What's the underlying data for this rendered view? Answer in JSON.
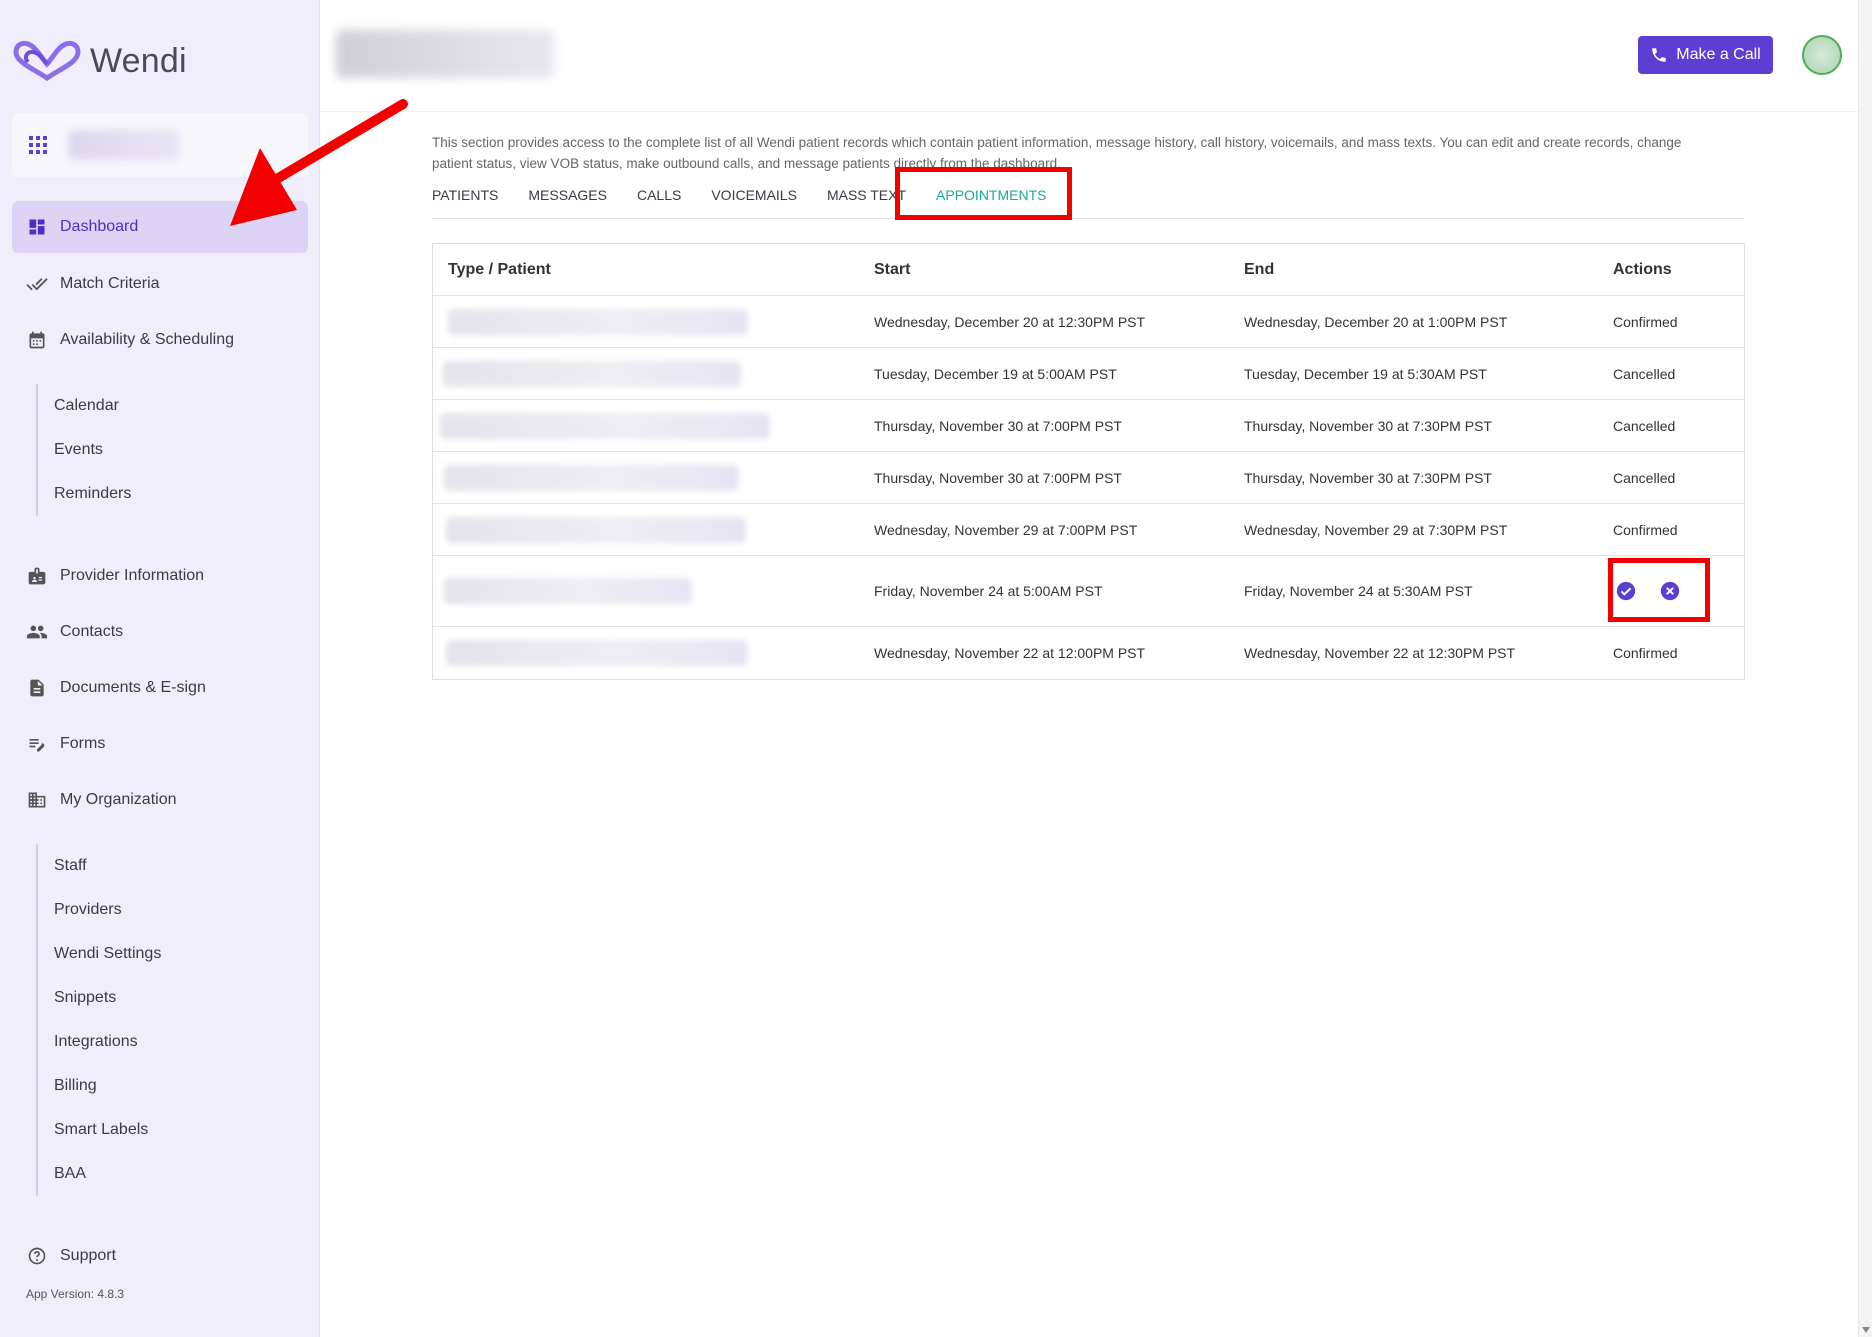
{
  "brand": {
    "name": "Wendi",
    "accent": "#5b3fd3",
    "tab_active": "#1aa89a",
    "annotation": "#f20000"
  },
  "sidebar": {
    "nav": [
      {
        "label": "Dashboard",
        "icon": "dashboard-icon"
      },
      {
        "label": "Match Criteria",
        "icon": "double-check-icon"
      },
      {
        "label": "Availability & Scheduling",
        "icon": "calendar-icon"
      }
    ],
    "scheduling_sub": [
      "Calendar",
      "Events",
      "Reminders"
    ],
    "nav2": [
      {
        "label": "Provider Information",
        "icon": "badge-icon"
      },
      {
        "label": "Contacts",
        "icon": "people-icon"
      },
      {
        "label": "Documents & E-sign",
        "icon": "document-icon"
      },
      {
        "label": "Forms",
        "icon": "edit-note-icon"
      },
      {
        "label": "My Organization",
        "icon": "building-icon"
      }
    ],
    "org_sub": [
      "Staff",
      "Providers",
      "Wendi Settings",
      "Snippets",
      "Integrations",
      "Billing",
      "Smart Labels",
      "BAA"
    ],
    "support": {
      "label": "Support",
      "icon": "help-circle-icon"
    },
    "app_version": "App Version: 4.8.3"
  },
  "header": {
    "call_label": "Make a Call"
  },
  "description": "This section provides access to the complete list of all Wendi patient records which contain patient information, message history, call history, voicemails, and mass texts. You can edit and create records, change patient status, view VOB status, make outbound calls, and message patients directly from the dashboard.",
  "tabs": [
    "PATIENTS",
    "MESSAGES",
    "CALLS",
    "VOICEMAILS",
    "MASS TEXT",
    "APPOINTMENTS"
  ],
  "table": {
    "columns": [
      "Type / Patient",
      "Start",
      "End",
      "Actions"
    ],
    "rows": [
      {
        "start": "Wednesday, December 20 at 12:30PM PST",
        "end": "Wednesday, December 20 at 1:00PM PST",
        "action": "Confirmed"
      },
      {
        "start": "Tuesday, December 19 at 5:00AM PST",
        "end": "Tuesday, December 19 at 5:30AM PST",
        "action": "Cancelled"
      },
      {
        "start": "Thursday, November 30 at 7:00PM PST",
        "end": "Thursday, November 30 at 7:30PM PST",
        "action": "Cancelled"
      },
      {
        "start": "Thursday, November 30 at 7:00PM PST",
        "end": "Thursday, November 30 at 7:30PM PST",
        "action": "Cancelled"
      },
      {
        "start": "Wednesday, November 29 at 7:00PM PST",
        "end": "Wednesday, November 29 at 7:30PM PST",
        "action": "Confirmed"
      },
      {
        "start": "Friday, November 24 at 5:00AM PST",
        "end": "Friday, November 24 at 5:30AM PST",
        "action": ""
      },
      {
        "start": "Wednesday, November 22 at 12:00PM PST",
        "end": "Wednesday, November 22 at 12:30PM PST",
        "action": "Confirmed"
      }
    ]
  }
}
